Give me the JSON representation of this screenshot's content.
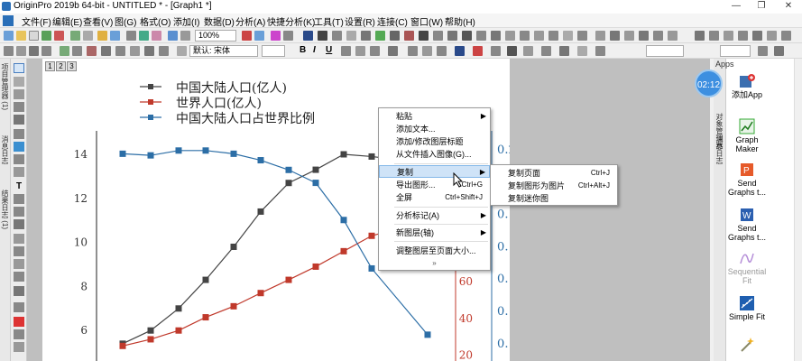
{
  "window": {
    "title": "OriginPro 2019b 64-bit - UNTITLED * - [Graph1 *]",
    "minimize": "—",
    "restore": "❐",
    "close": "✕"
  },
  "menu": [
    "文件(F)",
    "编辑(E)",
    "查看(V)",
    "图(G)",
    "格式(O)",
    "添加(I)",
    "数据(D)",
    "分析(A)",
    "快捷分析(K)",
    "工具(T)",
    "设置(R)",
    "连接(C)",
    "窗口(W)",
    "帮助(H)"
  ],
  "toolbar": {
    "zoom": "100%",
    "font": "默认: 宋体",
    "bold": "B",
    "italic": "I",
    "underline": "U"
  },
  "left_panel_tabs": [
    "项目管理器 (1)",
    "消息日志",
    "结果日志 (1)"
  ],
  "layer_tabs": [
    "1",
    "2",
    "3"
  ],
  "graph": {
    "legend": [
      "中国大陆人口(亿人)",
      "世界人口(亿人)",
      "中国大陆人口占世界比例"
    ],
    "left_axis_ticks": [
      "14",
      "12",
      "10",
      "8",
      "6"
    ],
    "red_axis_ticks": [
      "60",
      "40",
      "20"
    ],
    "blue_axis_ticks": [
      "0.22",
      "0.20",
      "0.18",
      "0.16",
      "0.14",
      "0.12",
      "0.10"
    ]
  },
  "chart_data": {
    "type": "line",
    "ylabel": "",
    "xlabel": "",
    "left_ylim": [
      5,
      15
    ],
    "series": [
      {
        "name": "中国大陆人口(亿人)",
        "color": "#444444",
        "axis": "left",
        "values": [
          5.4,
          6.0,
          7.0,
          8.3,
          9.8,
          11.4,
          12.7,
          13.3,
          14.0,
          13.9,
          13.6
        ]
      },
      {
        "name": "世界人口(亿人)",
        "color": "#c0392b",
        "axis": "left-scaled",
        "values": [
          5.3,
          5.6,
          6.0,
          6.6,
          7.1,
          7.7,
          8.3,
          8.9,
          9.6,
          10.3,
          11.0
        ]
      },
      {
        "name": "中国大陆人口占世界比例",
        "color": "#2c6ea6",
        "axis": "right",
        "values": [
          0.217,
          0.216,
          0.219,
          0.219,
          0.217,
          0.213,
          0.207,
          0.199,
          0.176,
          0.146,
          0.105
        ]
      }
    ]
  },
  "timer": "02:12",
  "context_menu": {
    "items": [
      {
        "label": "粘贴",
        "arrow": "▶"
      },
      {
        "label": "添加文本..."
      },
      {
        "label": "添加/修改图层标题"
      },
      {
        "label": "从文件插入图像(G)..."
      },
      {
        "label": "复制",
        "arrow": "▶",
        "highlight": true
      },
      {
        "label": "导出图形...",
        "shortcut": "Ctrl+G"
      },
      {
        "label": "全屏",
        "shortcut": "Ctrl+Shift+J"
      },
      {
        "label": "分析标记(A)",
        "arrow": "▶"
      },
      {
        "label": "新图层(轴)",
        "arrow": "▶"
      },
      {
        "label": "调整图层至页面大小..."
      }
    ],
    "more": "»"
  },
  "submenu": {
    "items": [
      {
        "label": "复制页面",
        "shortcut": "Ctrl+J"
      },
      {
        "label": "复制图形为图片",
        "shortcut": "Ctrl+Alt+J"
      },
      {
        "label": "复制迷你图"
      }
    ]
  },
  "apps": {
    "title": "Apps",
    "vtabs": [
      "对象管理器",
      "消息日志"
    ],
    "items": [
      {
        "label": "添加App"
      },
      {
        "label": "Graph Maker"
      },
      {
        "label": "Send Graphs t..."
      },
      {
        "label": "Send Graphs t..."
      },
      {
        "label": "Sequential Fit"
      },
      {
        "label": "Simple Fit"
      }
    ]
  }
}
